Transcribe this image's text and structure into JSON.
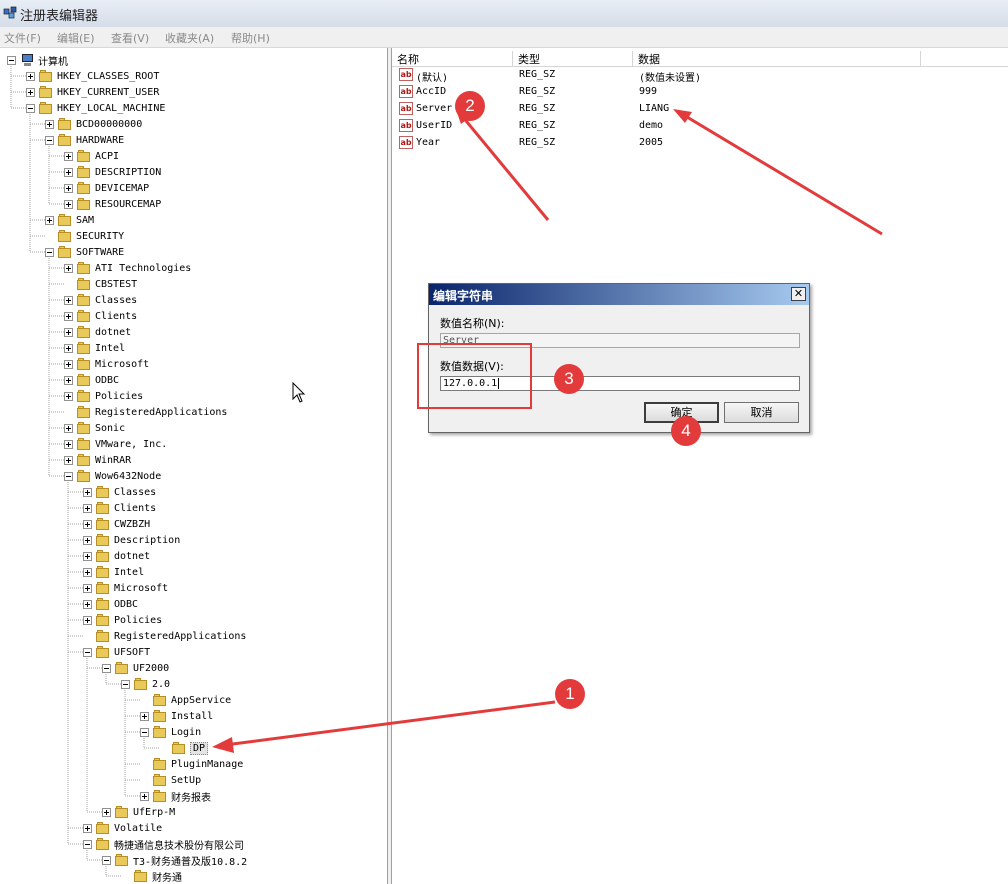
{
  "window": {
    "title": "注册表编辑器"
  },
  "menu": [
    "文件(F)",
    "编辑(E)",
    "查看(V)",
    "收藏夹(A)",
    "帮助(H)"
  ],
  "tree": [
    {
      "label": "计算机",
      "depth": 0,
      "exp": "minus",
      "icon": "computer"
    },
    {
      "label": "HKEY_CLASSES_ROOT",
      "depth": 1,
      "exp": "plus"
    },
    {
      "label": "HKEY_CURRENT_USER",
      "depth": 1,
      "exp": "plus"
    },
    {
      "label": "HKEY_LOCAL_MACHINE",
      "depth": 1,
      "exp": "minus"
    },
    {
      "label": "BCD00000000",
      "depth": 2,
      "exp": "plus"
    },
    {
      "label": "HARDWARE",
      "depth": 2,
      "exp": "minus"
    },
    {
      "label": "ACPI",
      "depth": 3,
      "exp": "plus"
    },
    {
      "label": "DESCRIPTION",
      "depth": 3,
      "exp": "plus"
    },
    {
      "label": "DEVICEMAP",
      "depth": 3,
      "exp": "plus"
    },
    {
      "label": "RESOURCEMAP",
      "depth": 3,
      "exp": "plus"
    },
    {
      "label": "SAM",
      "depth": 2,
      "exp": "plus"
    },
    {
      "label": "SECURITY",
      "depth": 2,
      "exp": "none"
    },
    {
      "label": "SOFTWARE",
      "depth": 2,
      "exp": "minus"
    },
    {
      "label": "ATI Technologies",
      "depth": 3,
      "exp": "plus"
    },
    {
      "label": "CBSTEST",
      "depth": 3,
      "exp": "none"
    },
    {
      "label": "Classes",
      "depth": 3,
      "exp": "plus"
    },
    {
      "label": "Clients",
      "depth": 3,
      "exp": "plus"
    },
    {
      "label": "dotnet",
      "depth": 3,
      "exp": "plus"
    },
    {
      "label": "Intel",
      "depth": 3,
      "exp": "plus"
    },
    {
      "label": "Microsoft",
      "depth": 3,
      "exp": "plus"
    },
    {
      "label": "ODBC",
      "depth": 3,
      "exp": "plus"
    },
    {
      "label": "Policies",
      "depth": 3,
      "exp": "plus"
    },
    {
      "label": "RegisteredApplications",
      "depth": 3,
      "exp": "none"
    },
    {
      "label": "Sonic",
      "depth": 3,
      "exp": "plus"
    },
    {
      "label": "VMware, Inc.",
      "depth": 3,
      "exp": "plus"
    },
    {
      "label": "WinRAR",
      "depth": 3,
      "exp": "plus"
    },
    {
      "label": "Wow6432Node",
      "depth": 3,
      "exp": "minus"
    },
    {
      "label": "Classes",
      "depth": 4,
      "exp": "plus"
    },
    {
      "label": "Clients",
      "depth": 4,
      "exp": "plus"
    },
    {
      "label": "CWZBZH",
      "depth": 4,
      "exp": "plus"
    },
    {
      "label": "Description",
      "depth": 4,
      "exp": "plus"
    },
    {
      "label": "dotnet",
      "depth": 4,
      "exp": "plus"
    },
    {
      "label": "Intel",
      "depth": 4,
      "exp": "plus"
    },
    {
      "label": "Microsoft",
      "depth": 4,
      "exp": "plus"
    },
    {
      "label": "ODBC",
      "depth": 4,
      "exp": "plus"
    },
    {
      "label": "Policies",
      "depth": 4,
      "exp": "plus"
    },
    {
      "label": "RegisteredApplications",
      "depth": 4,
      "exp": "none"
    },
    {
      "label": "UFSOFT",
      "depth": 4,
      "exp": "minus"
    },
    {
      "label": "UF2000",
      "depth": 5,
      "exp": "minus"
    },
    {
      "label": "2.0",
      "depth": 6,
      "exp": "minus"
    },
    {
      "label": "AppService",
      "depth": 7,
      "exp": "none"
    },
    {
      "label": "Install",
      "depth": 7,
      "exp": "plus"
    },
    {
      "label": "Login",
      "depth": 7,
      "exp": "minus"
    },
    {
      "label": "DP",
      "depth": 8,
      "exp": "none",
      "selected": true
    },
    {
      "label": "PluginManage",
      "depth": 7,
      "exp": "none"
    },
    {
      "label": "SetUp",
      "depth": 7,
      "exp": "none"
    },
    {
      "label": "财务报表",
      "depth": 7,
      "exp": "plus"
    },
    {
      "label": "UfErp-M",
      "depth": 5,
      "exp": "plus"
    },
    {
      "label": "Volatile",
      "depth": 4,
      "exp": "plus"
    },
    {
      "label": "畅捷通信息技术股份有限公司",
      "depth": 4,
      "exp": "minus"
    },
    {
      "label": "T3-财务通普及版10.8.2",
      "depth": 5,
      "exp": "minus"
    },
    {
      "label": "财务通",
      "depth": 6,
      "exp": "none"
    }
  ],
  "list": {
    "headers": [
      "名称",
      "类型",
      "数据"
    ],
    "rows": [
      {
        "name": "(默认)",
        "type": "REG_SZ",
        "data": "(数值未设置)"
      },
      {
        "name": "AccID",
        "type": "REG_SZ",
        "data": "999"
      },
      {
        "name": "Server",
        "type": "REG_SZ",
        "data": "LIANG"
      },
      {
        "name": "UserID",
        "type": "REG_SZ",
        "data": "demo"
      },
      {
        "name": "Year",
        "type": "REG_SZ",
        "data": "2005"
      }
    ],
    "icon_text": "ab"
  },
  "dialog": {
    "title": "编辑字符串",
    "close": "✕",
    "name_label": "数值名称(N):",
    "name_value": "Server",
    "data_label": "数值数据(V):",
    "data_value": "127.0.0.1",
    "ok": "确定",
    "cancel": "取消"
  },
  "markers": [
    "1",
    "2",
    "3",
    "4"
  ],
  "colors": {
    "annotation": "#e33b3b",
    "folder": "#eac95b"
  }
}
